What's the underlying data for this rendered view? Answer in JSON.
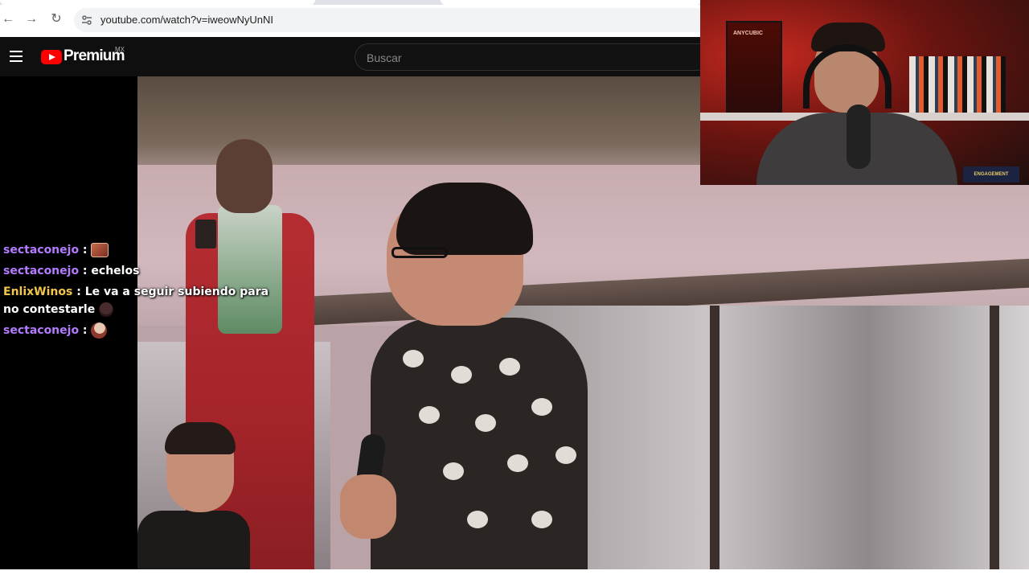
{
  "browser": {
    "url": "youtube.com/watch?v=iweowNyUnNI",
    "back_icon": "←",
    "forward_icon": "→",
    "reload_icon": "↻"
  },
  "youtube": {
    "logo_text": "Premium",
    "region": "MX",
    "search_placeholder": "Buscar"
  },
  "chat": [
    {
      "user": "sectaconejo",
      "user_color": "#b47bff",
      "text": "",
      "emote": "ticket"
    },
    {
      "user": "sectaconejo",
      "user_color": "#b47bff",
      "text": "echelos",
      "emote": ""
    },
    {
      "user": "EnlixWinos",
      "user_color": "#f3c54a",
      "text": "Le va a seguir subiendo para no contestarle",
      "emote": "head"
    },
    {
      "user": "sectaconejo",
      "user_color": "#b47bff",
      "text": "",
      "emote": "bald"
    }
  ],
  "webcam": {
    "printer_label": "ANYCUBIC",
    "book_label": "ENGAGEMENT"
  },
  "colors": {
    "yt_red": "#ff0000",
    "header_bg": "#0f0f0f"
  }
}
